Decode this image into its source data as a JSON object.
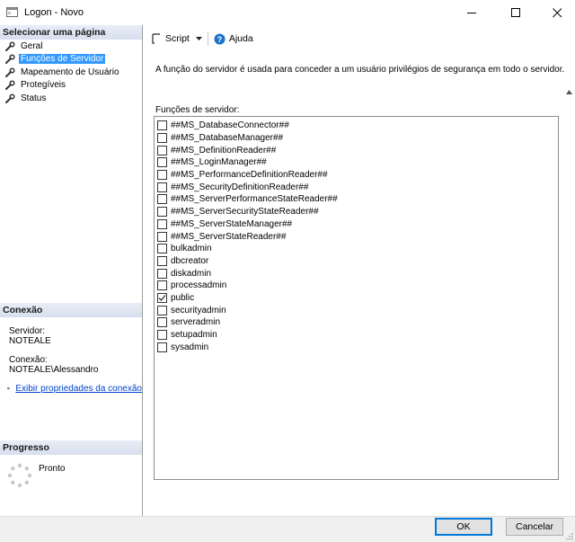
{
  "window": {
    "title": "Logon - Novo",
    "icon": "sql-logon-icon"
  },
  "left_pane": {
    "select_page_header": "Selecionar uma página",
    "pages": [
      {
        "label": "Geral",
        "selected": false
      },
      {
        "label": "Funções de Servidor",
        "selected": true
      },
      {
        "label": "Mapeamento de Usuário",
        "selected": false
      },
      {
        "label": "Protegíveis",
        "selected": false
      },
      {
        "label": "Status",
        "selected": false
      }
    ],
    "connection": {
      "header": "Conexão",
      "server_label": "Servidor:",
      "server_value": "NOTEALE",
      "connection_label": "Conexão:",
      "connection_value": "NOTEALE\\Alessandro",
      "view_properties_link": "Exibir propriedades da conexão"
    },
    "progress": {
      "header": "Progresso",
      "status": "Pronto"
    }
  },
  "toolbar": {
    "script_label": "Script",
    "help_label": "Ajuda"
  },
  "main": {
    "description": "A função do servidor é usada para conceder a um usuário privilégios de segurança em todo o servidor.",
    "roles_label": "Funções de servidor:",
    "roles": [
      {
        "name": "##MS_DatabaseConnector##",
        "checked": false
      },
      {
        "name": "##MS_DatabaseManager##",
        "checked": false
      },
      {
        "name": "##MS_DefinitionReader##",
        "checked": false
      },
      {
        "name": "##MS_LoginManager##",
        "checked": false
      },
      {
        "name": "##MS_PerformanceDefinitionReader##",
        "checked": false
      },
      {
        "name": "##MS_SecurityDefinitionReader##",
        "checked": false
      },
      {
        "name": "##MS_ServerPerformanceStateReader##",
        "checked": false
      },
      {
        "name": "##MS_ServerSecurityStateReader##",
        "checked": false
      },
      {
        "name": "##MS_ServerStateManager##",
        "checked": false
      },
      {
        "name": "##MS_ServerStateReader##",
        "checked": false
      },
      {
        "name": "bulkadmin",
        "checked": false
      },
      {
        "name": "dbcreator",
        "checked": false
      },
      {
        "name": "diskadmin",
        "checked": false
      },
      {
        "name": "processadmin",
        "checked": false
      },
      {
        "name": "public",
        "checked": true
      },
      {
        "name": "securityadmin",
        "checked": false
      },
      {
        "name": "serveradmin",
        "checked": false
      },
      {
        "name": "setupadmin",
        "checked": false
      },
      {
        "name": "sysadmin",
        "checked": false
      }
    ]
  },
  "footer": {
    "ok_label": "OK",
    "cancel_label": "Cancelar"
  },
  "colors": {
    "selection": "#3399ff",
    "link": "#0044cc",
    "section_header": "#d6dfee",
    "default_button_border": "#0078d7"
  }
}
